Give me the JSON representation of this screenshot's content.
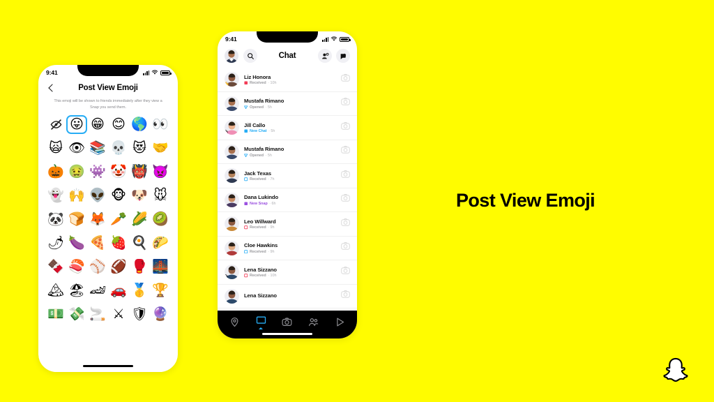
{
  "background_color": "#FFFC00",
  "side_title": "Post View Emoji",
  "brand_logo": "snapchat-ghost-logo",
  "phone_left": {
    "status_bar": {
      "time": "9:41",
      "signal_icon": "signal-bars-icon",
      "wifi_icon": "wifi-icon",
      "battery_icon": "battery-icon"
    },
    "screen": "post-view-emoji",
    "back_icon": "back-chevron-icon",
    "title": "Post View Emoji",
    "subtitle": "This emoji will be shown to friends immediately after they view a Snap you send them.",
    "selected_index": 1,
    "emoji_grid": [
      {
        "name": "no-emoji",
        "glyph": "",
        "icon": "eye-slash-icon"
      },
      {
        "name": "face-with-tongue",
        "glyph": "😛"
      },
      {
        "name": "grinning-face-with-teeth",
        "glyph": "😁"
      },
      {
        "name": "smiling-face-smiling-eyes",
        "glyph": "😊"
      },
      {
        "name": "globe-americas",
        "glyph": "🌎"
      },
      {
        "name": "eyes",
        "glyph": "👀"
      },
      {
        "name": "weary-cat",
        "glyph": "🙀"
      },
      {
        "name": "eye",
        "glyph": "👁"
      },
      {
        "name": "books",
        "glyph": "📚"
      },
      {
        "name": "skull",
        "glyph": "💀"
      },
      {
        "name": "smiling-cat-heart-eyes",
        "glyph": "😻"
      },
      {
        "name": "handshake",
        "glyph": "🤝"
      },
      {
        "name": "jack-o-lantern",
        "glyph": "🎃"
      },
      {
        "name": "nauseated-face",
        "glyph": "🤢"
      },
      {
        "name": "alien-monster",
        "glyph": "👾"
      },
      {
        "name": "clown-face",
        "glyph": "🤡"
      },
      {
        "name": "ogre",
        "glyph": "👹"
      },
      {
        "name": "angry-face-with-horns",
        "glyph": "👿"
      },
      {
        "name": "ghost",
        "glyph": "👻"
      },
      {
        "name": "raising-hands",
        "glyph": "🙌"
      },
      {
        "name": "alien",
        "glyph": "👽"
      },
      {
        "name": "monkey-face",
        "glyph": "🐵"
      },
      {
        "name": "dog-face",
        "glyph": "🐶"
      },
      {
        "name": "mouse-face",
        "glyph": "🐭"
      },
      {
        "name": "panda",
        "glyph": "🐼"
      },
      {
        "name": "bread",
        "glyph": "🍞"
      },
      {
        "name": "fox",
        "glyph": "🦊"
      },
      {
        "name": "carrot",
        "glyph": "🥕"
      },
      {
        "name": "ear-of-corn",
        "glyph": "🌽"
      },
      {
        "name": "kiwi-fruit",
        "glyph": "🥝"
      },
      {
        "name": "hot-pepper",
        "glyph": "🌶"
      },
      {
        "name": "eggplant",
        "glyph": "🍆"
      },
      {
        "name": "pizza",
        "glyph": "🍕"
      },
      {
        "name": "strawberry",
        "glyph": "🍓"
      },
      {
        "name": "cooking-egg",
        "glyph": "🍳"
      },
      {
        "name": "taco",
        "glyph": "🌮"
      },
      {
        "name": "chocolate-bar",
        "glyph": "🍫"
      },
      {
        "name": "sushi",
        "glyph": "🍣"
      },
      {
        "name": "baseball",
        "glyph": "⚾"
      },
      {
        "name": "american-football",
        "glyph": "🏈"
      },
      {
        "name": "boxing-glove",
        "glyph": "🥊"
      },
      {
        "name": "bridge-at-night",
        "glyph": "🌉"
      },
      {
        "name": "snow-capped-mountain",
        "glyph": "🏔"
      },
      {
        "name": "beach-with-umbrella",
        "glyph": "🏖"
      },
      {
        "name": "racing-car",
        "glyph": "🏎"
      },
      {
        "name": "automobile",
        "glyph": "🚗"
      },
      {
        "name": "first-place-medal",
        "glyph": "🥇"
      },
      {
        "name": "trophy",
        "glyph": "🏆"
      },
      {
        "name": "dollar-banknote",
        "glyph": "💵"
      },
      {
        "name": "money-with-wings",
        "glyph": "💸"
      },
      {
        "name": "cigarette",
        "glyph": "🚬"
      },
      {
        "name": "crossed-swords",
        "glyph": "⚔"
      },
      {
        "name": "shield",
        "glyph": "🛡"
      },
      {
        "name": "crystal-ball",
        "glyph": "🔮"
      }
    ]
  },
  "phone_right": {
    "status_bar": {
      "time": "9:41",
      "signal_icon": "signal-bars-icon",
      "wifi_icon": "wifi-icon",
      "battery_icon": "battery-icon"
    },
    "screen": "chat",
    "header": {
      "avatar": "user-avatar",
      "search_icon": "search-icon",
      "title": "Chat",
      "add_friend_icon": "add-friend-icon",
      "new_chat_icon": "new-chat-icon"
    },
    "chats": [
      {
        "name": "Liz Honora",
        "status": "Received",
        "time": "10h",
        "status_type": "received-snap",
        "status_color": "#9a9a9e",
        "icon": "snap-received-icon",
        "badge_emoji": "👋",
        "avatar_color": "#6b4a3a",
        "skin": "#8d5a41"
      },
      {
        "name": "Mustafa Rimano",
        "status": "Opened",
        "time": "5h",
        "status_type": "chat-opened",
        "status_color": "#9a9a9e",
        "icon": "chat-opened-icon",
        "badge_emoji": "",
        "avatar_color": "#3a4a6b",
        "skin": "#a9714f"
      },
      {
        "name": "Jill Callo",
        "status": "New Chat",
        "time": "5h",
        "status_type": "new-chat",
        "status_color": "#27ADF5",
        "icon": "new-chat-square-icon",
        "badge_emoji": "😊",
        "avatar_color": "#f08fb5",
        "skin": "#e9b08e"
      },
      {
        "name": "Mustafa Rimano",
        "status": "Opened",
        "time": "5h",
        "status_type": "chat-opened",
        "status_color": "#9a9a9e",
        "icon": "chat-opened-icon",
        "badge_emoji": "",
        "avatar_color": "#3a4a6b",
        "skin": "#a9714f"
      },
      {
        "name": "Jack Texas",
        "status": "Received",
        "time": "7h",
        "status_type": "new-chat-received",
        "status_color": "#9a9a9e",
        "icon": "chat-received-icon",
        "badge_emoji": "",
        "avatar_color": "#2f3a52",
        "skin": "#b5835c"
      },
      {
        "name": "Dana Lukindo",
        "status": "New Snap",
        "time": "6h",
        "status_type": "new-snap",
        "status_color": "#9B51E0",
        "icon": "new-snap-square-icon",
        "badge_emoji": "",
        "avatar_color": "#4a3b62",
        "skin": "#c68a63"
      },
      {
        "name": "Leo Willward",
        "status": "Received",
        "time": "9h",
        "status_type": "snap-received",
        "status_color": "#9a9a9e",
        "icon": "snap-received-red-icon",
        "badge_emoji": "",
        "avatar_color": "#c98a3a",
        "skin": "#8d5a41"
      },
      {
        "name": "Cloe Hawkins",
        "status": "Received",
        "time": "9h",
        "status_type": "chat-received",
        "status_color": "#9a9a9e",
        "icon": "chat-received-blue-icon",
        "badge_emoji": "",
        "avatar_color": "#b03a3a",
        "skin": "#e0ab84"
      },
      {
        "name": "Lena Sizzano",
        "status": "Received",
        "time": "10h",
        "status_type": "snap-received",
        "status_color": "#9a9a9e",
        "icon": "snap-received-red-icon",
        "badge_emoji": "😊",
        "avatar_color": "#2d4a6b",
        "skin": "#8d5a41"
      },
      {
        "name": "Lena Sizzano",
        "status": "",
        "time": "",
        "status_type": "",
        "status_color": "#9a9a9e",
        "icon": "",
        "badge_emoji": "",
        "avatar_color": "#2d4a6b",
        "skin": "#8d5a41"
      }
    ],
    "bottom_nav": [
      {
        "name": "map-pin-icon",
        "active": false
      },
      {
        "name": "chat-icon",
        "active": true
      },
      {
        "name": "camera-icon",
        "active": false
      },
      {
        "name": "friends-icon",
        "active": false
      },
      {
        "name": "discover-play-icon",
        "active": false
      }
    ]
  }
}
